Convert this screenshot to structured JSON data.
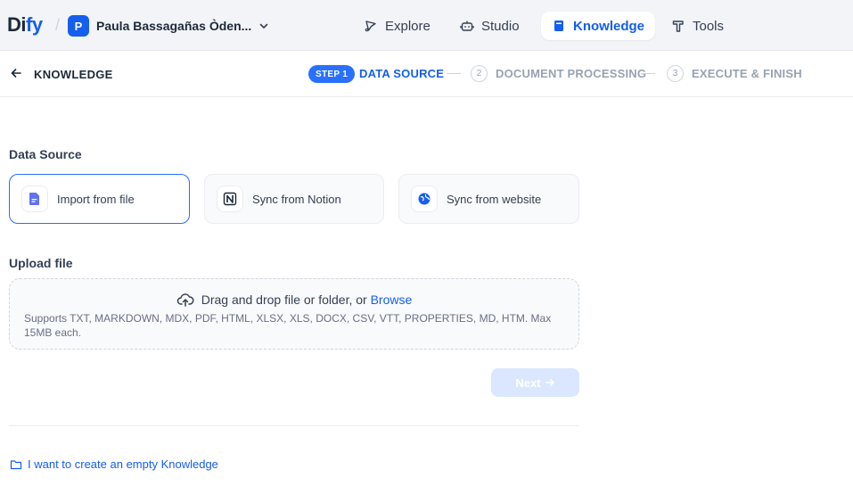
{
  "header": {
    "logo_main": "Di",
    "logo_accent": "fy",
    "workspace_initial": "P",
    "workspace_name": "Paula Bassagañas Òden...",
    "nav": {
      "explore": "Explore",
      "studio": "Studio",
      "knowledge": "Knowledge",
      "tools": "Tools"
    },
    "active_nav": "knowledge"
  },
  "stepper": {
    "back_label": "KNOWLEDGE",
    "step1_badge": "STEP 1",
    "step1_label": "DATA SOURCE",
    "step2_num": "2",
    "step2_label": "DOCUMENT PROCESSING",
    "step3_num": "3",
    "step3_label": "EXECUTE & FINISH"
  },
  "data_source": {
    "title": "Data Source",
    "options": [
      {
        "label": "Import from file",
        "icon": "file-icon",
        "selected": true
      },
      {
        "label": "Sync from Notion",
        "icon": "notion-icon",
        "selected": false
      },
      {
        "label": "Sync from website",
        "icon": "website-icon",
        "selected": false
      }
    ]
  },
  "upload": {
    "title": "Upload file",
    "drag_text": "Drag and drop file or folder, or",
    "browse_text": "Browse",
    "hint": "Supports TXT, MARKDOWN, MDX, PDF, HTML, XLSX, XLS, DOCX, CSV, VTT, PROPERTIES, MD, HTM. Max 15MB each."
  },
  "actions": {
    "next_label": "Next",
    "next_enabled": false
  },
  "footer": {
    "empty_link": "I want to create an empty Knowledge"
  },
  "colors": {
    "accent": "#155eef",
    "step_badge": "#2970ff",
    "next_disabled_bg": "#dbe7ff"
  }
}
